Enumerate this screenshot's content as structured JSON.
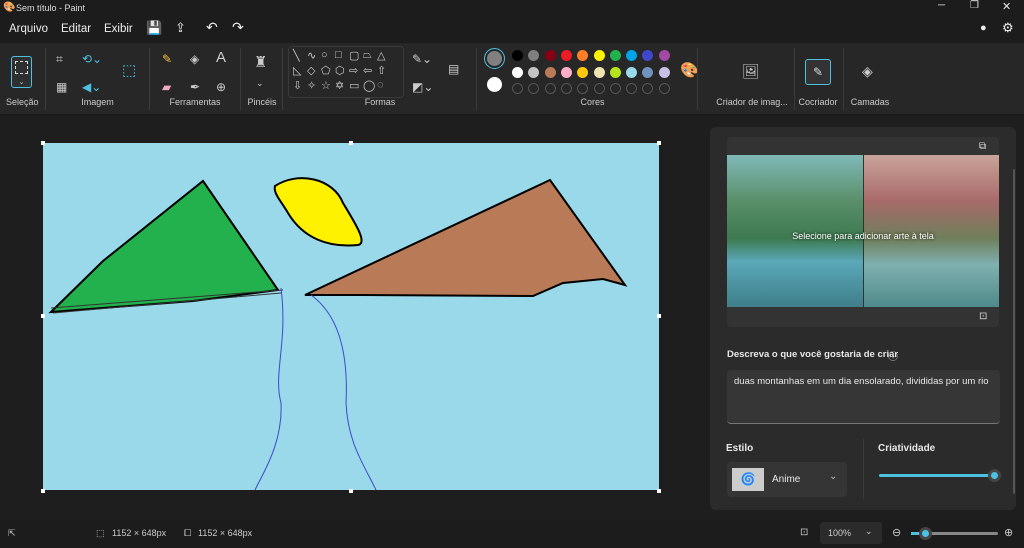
{
  "window": {
    "title": "Sem título - Paint"
  },
  "menu": {
    "file": "Arquivo",
    "edit": "Editar",
    "view": "Exibir"
  },
  "ribbon": {
    "groups": {
      "selection": "Seleção",
      "image": "Imagem",
      "tools": "Ferramentas",
      "brushes": "Pincéis",
      "shapes": "Formas",
      "colors": "Cores",
      "image_creator": "Criador de imag...",
      "cocreator": "Cocriador",
      "layers": "Camadas"
    },
    "colors": {
      "primary": "#808080",
      "secondary": "#ffffff",
      "palette_row1": [
        "#000000",
        "#7f7f7f",
        "#880015",
        "#ed1c24",
        "#ff7f27",
        "#fff200",
        "#22b14c",
        "#00a2e8",
        "#3f48cc",
        "#a349a4"
      ],
      "palette_row2": [
        "#ffffff",
        "#c3c3c3",
        "#b97a57",
        "#ffaec9",
        "#ffc90e",
        "#efe4b0",
        "#b5e61d",
        "#99d9ea",
        "#7092be",
        "#c8bfe7"
      ]
    },
    "shapes": [
      "╲",
      "∿",
      "○",
      "□",
      "▢",
      "⏢",
      "△",
      "◺",
      "◇",
      "⬠",
      "⬡",
      "⇨",
      "⇦",
      "⇧",
      "⇩",
      "✧",
      "☆",
      "✡",
      "▭",
      "◯",
      "◌"
    ]
  },
  "cocreator": {
    "overlay_text": "Selecione para adicionar arte à tela",
    "prompt_label": "Descreva o que você gostaria de criar",
    "prompt_value": "duas montanhas em um dia ensolarado, divididas por um rio",
    "style_label": "Estilo",
    "style_value": "Anime",
    "creativity_label": "Criatividade",
    "creativity_value": 1.0
  },
  "status": {
    "selection_size": "1152 × 648px",
    "canvas_size": "1152 × 648px",
    "zoom": "100%",
    "zoom_slider": 0.12
  },
  "accent": "#4cc2e0"
}
